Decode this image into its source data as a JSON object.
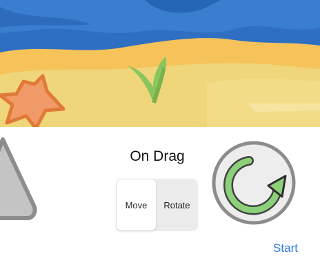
{
  "panel": {
    "title": "On Drag",
    "segments": [
      {
        "label": "Move",
        "selected": true
      },
      {
        "label": "Rotate",
        "selected": false
      }
    ],
    "start_label": "Start"
  },
  "scene": {
    "sea_color": "#2f6fc2",
    "sand_color": "#f0d67a",
    "starfish_color": "#ef9a67",
    "seaweed_color": "#8cc45e"
  },
  "colors": {
    "accent": "#2f7be8",
    "shape_gray": "#c4c4c4",
    "rotate_arrow_green": "#8cd07a"
  },
  "icons": {
    "rotate": "rotate-arrow-icon",
    "triangle": "triangle-shape"
  }
}
